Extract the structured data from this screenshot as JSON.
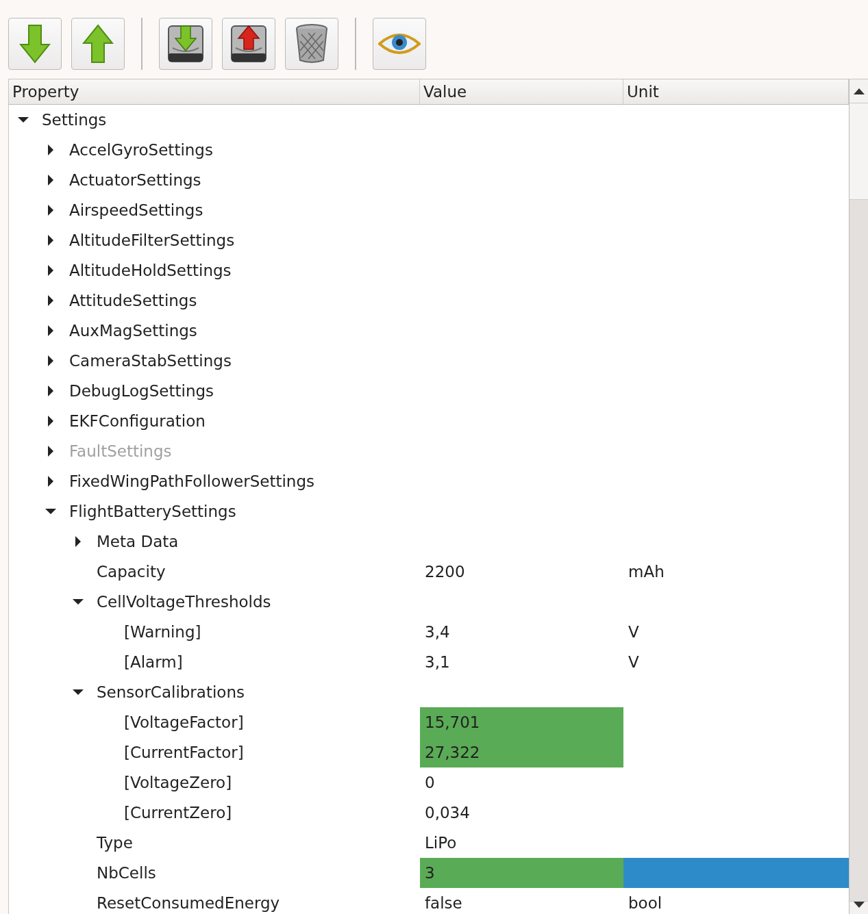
{
  "toolbar": {
    "groups": [
      {
        "buttons": [
          {
            "kind": "down"
          },
          {
            "kind": "up"
          }
        ]
      },
      {
        "buttons": [
          {
            "kind": "diskdown"
          },
          {
            "kind": "diskup"
          },
          {
            "kind": "trash"
          }
        ]
      },
      {
        "buttons": [
          {
            "kind": "eye"
          }
        ]
      }
    ]
  },
  "table": {
    "columns": [
      "Property",
      "Value",
      "Unit"
    ],
    "rows": [
      {
        "name": "Settings",
        "expanded": true,
        "selected": false,
        "disabled": false,
        "children": [
          {
            "name": "AccelGyroSettings",
            "expanded": false,
            "selected": false,
            "disabled": false
          },
          {
            "name": "ActuatorSettings",
            "expanded": false,
            "selected": false,
            "disabled": false
          },
          {
            "name": "AirspeedSettings",
            "expanded": false,
            "selected": false,
            "disabled": false
          },
          {
            "name": "AltitudeFilterSettings",
            "expanded": false,
            "selected": false,
            "disabled": false
          },
          {
            "name": "AltitudeHoldSettings",
            "expanded": false,
            "selected": false,
            "disabled": false
          },
          {
            "name": "AttitudeSettings",
            "expanded": false,
            "selected": false,
            "disabled": false
          },
          {
            "name": "AuxMagSettings",
            "expanded": false,
            "selected": false,
            "disabled": false
          },
          {
            "name": "CameraStabSettings",
            "expanded": false,
            "selected": false,
            "disabled": false
          },
          {
            "name": "DebugLogSettings",
            "expanded": false,
            "selected": false,
            "disabled": false
          },
          {
            "name": "EKFConfiguration",
            "expanded": false,
            "selected": false,
            "disabled": false
          },
          {
            "name": "FaultSettings",
            "expanded": false,
            "selected": false,
            "disabled": true
          },
          {
            "name": "FixedWingPathFollowerSettings",
            "expanded": false,
            "selected": false,
            "disabled": false
          },
          {
            "name": "FlightBatterySettings",
            "expanded": true,
            "selected": false,
            "disabled": false,
            "children": [
              {
                "name": "Meta Data",
                "expanded": false,
                "selected": false,
                "disabled": false
              },
              {
                "name": "Capacity",
                "value": "2200",
                "unit": "mAh",
                "highlighted": false,
                "selected": false,
                "disabled": false
              },
              {
                "name": "CellVoltageThresholds",
                "expanded": true,
                "selected": false,
                "disabled": false,
                "children": [
                  {
                    "name": "[Warning]",
                    "value": "3,4",
                    "unit": "V",
                    "highlighted": false,
                    "selected": false,
                    "disabled": false
                  },
                  {
                    "name": "[Alarm]",
                    "value": "3,1",
                    "unit": "V",
                    "highlighted": false,
                    "selected": false,
                    "disabled": false
                  }
                ]
              },
              {
                "name": "SensorCalibrations",
                "expanded": true,
                "selected": false,
                "disabled": false,
                "children": [
                  {
                    "name": "[VoltageFactor]",
                    "value": "15,701",
                    "highlighted": true,
                    "selected": false,
                    "disabled": false
                  },
                  {
                    "name": "[CurrentFactor]",
                    "value": "27,322",
                    "highlighted": true,
                    "selected": false,
                    "disabled": false
                  },
                  {
                    "name": "[VoltageZero]",
                    "value": "0",
                    "highlighted": false,
                    "selected": false,
                    "disabled": false
                  },
                  {
                    "name": "[CurrentZero]",
                    "value": "0,034",
                    "highlighted": false,
                    "selected": false,
                    "disabled": false
                  }
                ]
              },
              {
                "name": "Type",
                "value": "LiPo",
                "highlighted": false,
                "selected": false,
                "disabled": false
              },
              {
                "name": "NbCells",
                "value": "3",
                "highlighted": true,
                "selected": true,
                "disabled": false
              },
              {
                "name": "ResetConsumedEnergy",
                "value": "false",
                "unit": "bool",
                "highlighted": false,
                "selected": false,
                "disabled": false
              }
            ]
          }
        ]
      }
    ]
  }
}
